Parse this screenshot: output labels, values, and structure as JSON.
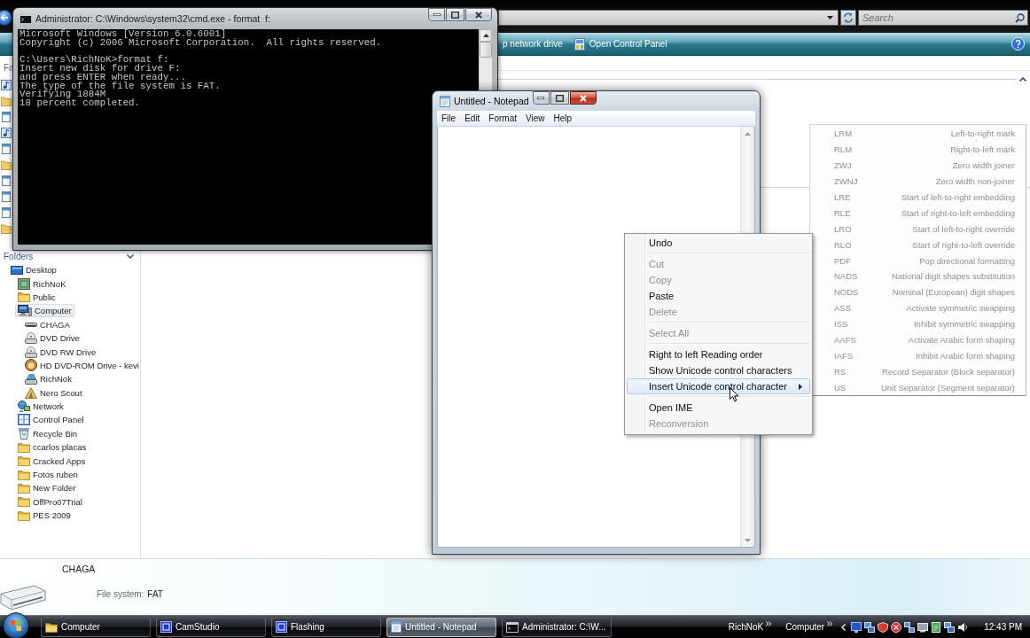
{
  "explorer": {
    "search_placeholder": "Search",
    "toolbar": [
      {
        "label": "p network drive",
        "icon": false
      },
      {
        "label": "Open Control Panel",
        "icon": true
      }
    ],
    "nav": {
      "links_header": "Fa",
      "folders_header": "Folders",
      "tree": [
        {
          "label": "Desktop",
          "kind": "desktop",
          "selected": false,
          "children": [
            {
              "label": "RichNoK",
              "kind": "user",
              "selected": false
            },
            {
              "label": "Public",
              "kind": "folder",
              "selected": false
            },
            {
              "label": "Computer",
              "kind": "computer",
              "selected": true,
              "children": [
                {
                  "label": "CHAGA",
                  "kind": "removable",
                  "selected": false
                },
                {
                  "label": "DVD Drive",
                  "kind": "dvd",
                  "selected": false
                },
                {
                  "label": "DVD RW Drive",
                  "kind": "dvd",
                  "selected": false
                },
                {
                  "label": "HD DVD-ROM Drive - kevi",
                  "kind": "hddvd",
                  "selected": false
                },
                {
                  "label": "RichNok",
                  "kind": "netdrive",
                  "selected": false
                },
                {
                  "label": "Nero Scout",
                  "kind": "scout",
                  "selected": false
                }
              ]
            },
            {
              "label": "Network",
              "kind": "network",
              "selected": false
            },
            {
              "label": "Control Panel",
              "kind": "control-panel",
              "selected": false
            },
            {
              "label": "Recycle Bin",
              "kind": "recycle-bin",
              "selected": false
            },
            {
              "label": "ccarlos placas",
              "kind": "folder",
              "selected": false
            },
            {
              "label": "Cracked Apps",
              "kind": "folder",
              "selected": false
            },
            {
              "label": "Fotos ruben",
              "kind": "folder",
              "selected": false
            },
            {
              "label": "New Folder",
              "kind": "folder",
              "selected": false
            },
            {
              "label": "OffPro07Trial",
              "kind": "folder",
              "selected": false
            },
            {
              "label": "PES 2009",
              "kind": "folder",
              "selected": false
            }
          ]
        }
      ]
    },
    "details": {
      "title": "CHAGA",
      "fields": [
        {
          "label": "File system:",
          "value": "FAT"
        }
      ]
    }
  },
  "cmd": {
    "title": "Administrator: C:\\Windows\\system32\\cmd.exe - format  f:",
    "active": false,
    "output": [
      {
        "lines": [
          "Microsoft Windows [Version 6.0.6001]",
          "Copyright (c) 2006 Microsoft Corporation.  All rights reserved."
        ]
      },
      {
        "lines": [
          "C:\\Users\\RichNoK>format f:",
          "Insert new disk for drive F:",
          "and press ENTER when ready...",
          "The type of the file system is FAT.",
          "Verifying 1884M",
          "18 percent completed."
        ]
      }
    ]
  },
  "notepad": {
    "title": "Untitled - Notepad",
    "active": true,
    "menu": [
      "File",
      "Edit",
      "Format",
      "View",
      "Help"
    ]
  },
  "context_menu": {
    "items": [
      {
        "kind": "item",
        "label": "Undo",
        "disabled": false,
        "highlighted": false,
        "submenu": false
      },
      {
        "kind": "separator"
      },
      {
        "kind": "item",
        "label": "Cut",
        "disabled": true,
        "highlighted": false,
        "submenu": false
      },
      {
        "kind": "item",
        "label": "Copy",
        "disabled": true,
        "highlighted": false,
        "submenu": false
      },
      {
        "kind": "item",
        "label": "Paste",
        "disabled": false,
        "highlighted": false,
        "submenu": false
      },
      {
        "kind": "item",
        "label": "Delete",
        "disabled": true,
        "highlighted": false,
        "submenu": false
      },
      {
        "kind": "separator"
      },
      {
        "kind": "item",
        "label": "Select All",
        "disabled": true,
        "highlighted": false,
        "submenu": false
      },
      {
        "kind": "separator"
      },
      {
        "kind": "item",
        "label": "Right to left Reading order",
        "disabled": false,
        "highlighted": false,
        "submenu": false
      },
      {
        "kind": "item",
        "label": "Show Unicode control characters",
        "disabled": false,
        "highlighted": false,
        "submenu": false
      },
      {
        "kind": "item",
        "label": "Insert Unicode control character",
        "disabled": false,
        "highlighted": true,
        "submenu": true
      },
      {
        "kind": "separator"
      },
      {
        "kind": "item",
        "label": "Open IME",
        "disabled": false,
        "highlighted": false,
        "submenu": false
      },
      {
        "kind": "item",
        "label": "Reconversion",
        "disabled": true,
        "highlighted": false,
        "submenu": false
      }
    ]
  },
  "submenu": {
    "items": [
      {
        "code": "LRM",
        "description": "Left-to-right mark"
      },
      {
        "code": "RLM",
        "description": "Right-to-left mark"
      },
      {
        "code": "ZWJ",
        "description": "Zero width joiner"
      },
      {
        "code": "ZWNJ",
        "description": "Zero width non-joiner"
      },
      {
        "code": "LRE",
        "description": "Start of left-to-right embedding"
      },
      {
        "code": "RLE",
        "description": "Start of right-to-left embedding"
      },
      {
        "code": "LRO",
        "description": "Start of left-to-right override"
      },
      {
        "code": "RLO",
        "description": "Start of right-to-left override"
      },
      {
        "code": "PDF",
        "description": "Pop directional formatting"
      },
      {
        "code": "NADS",
        "description": "National digit shapes substitution"
      },
      {
        "code": "NODS",
        "description": "Nominal (European) digit shapes"
      },
      {
        "code": "ASS",
        "description": "Activate symmetric swapping"
      },
      {
        "code": "ISS",
        "description": "Inhibit symmetric swapping"
      },
      {
        "code": "AAFS",
        "description": "Activate Arabic form shaping"
      },
      {
        "code": "IAFS",
        "description": "Inhibit Arabic form shaping"
      },
      {
        "code": "RS",
        "description": "Record Separator (Block separator)"
      },
      {
        "code": "US",
        "description": "Unit Separator (Segment separator)"
      }
    ]
  },
  "taskbar": {
    "buttons": [
      {
        "label": "Computer",
        "kind": "explorer",
        "active": false
      },
      {
        "label": "CamStudio",
        "kind": "app",
        "active": false
      },
      {
        "label": "Flashing",
        "kind": "app",
        "active": false
      },
      {
        "label": "Untitled - Notepad",
        "kind": "notepad",
        "active": true
      },
      {
        "label": "Administrator: C:\\W...",
        "kind": "console",
        "active": false
      }
    ],
    "toolbars": [
      "RichNoK",
      "Computer"
    ],
    "clock": "12:43 PM"
  }
}
